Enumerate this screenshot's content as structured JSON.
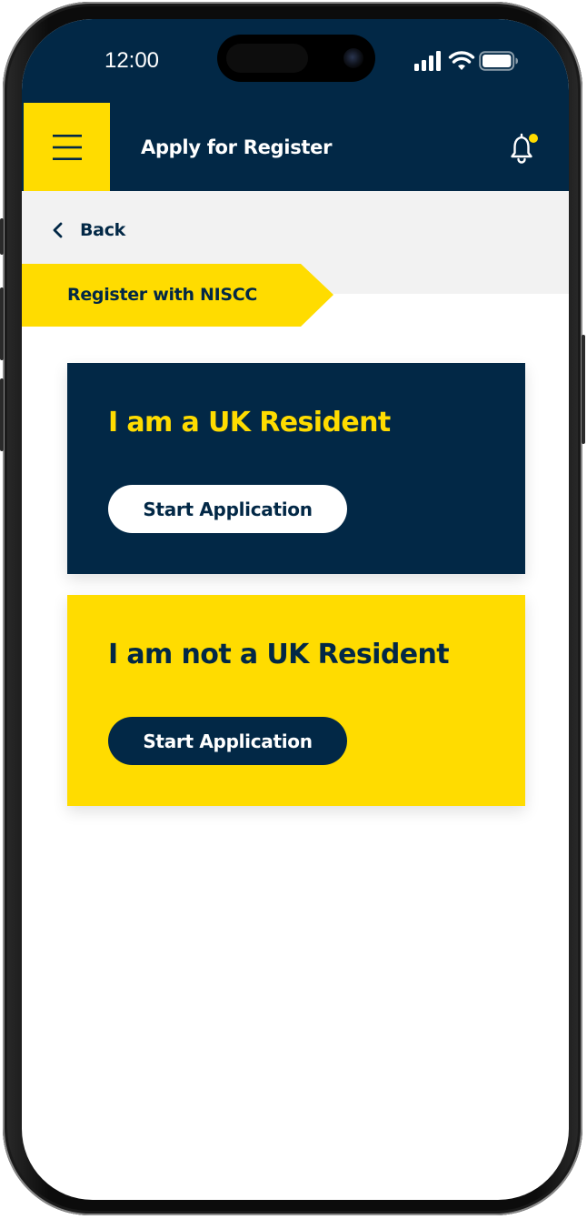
{
  "status_bar": {
    "time": "12:00",
    "icons": [
      "cellular-signal-icon",
      "wifi-icon",
      "battery-icon"
    ]
  },
  "header": {
    "menu_icon": "hamburger-menu-icon",
    "title": "Apply for Register",
    "notification_icon": "bell-icon",
    "has_unread_notification": true
  },
  "navigation": {
    "back_label": "Back",
    "section_label": "Register with NISCC"
  },
  "options": [
    {
      "title": "I am a UK Resident",
      "button_label": "Start Application"
    },
    {
      "title": "I am not a UK Resident",
      "button_label": "Start Application"
    }
  ],
  "colors": {
    "navy": "#022846",
    "yellow": "#FFDC00",
    "light_grey": "#F2F2F2",
    "white": "#FFFFFF"
  }
}
